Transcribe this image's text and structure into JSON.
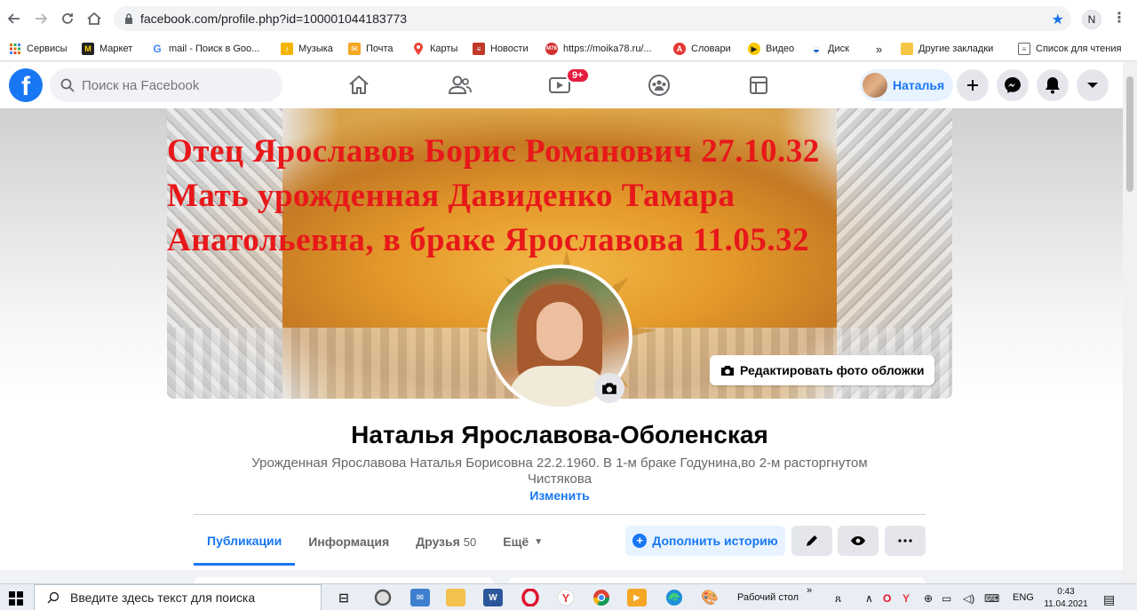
{
  "browser": {
    "url": "facebook.com/profile.php?id=100001044183773",
    "profile_initial": "N",
    "kebab": "⋮"
  },
  "bookmarks": [
    {
      "label": "Сервисы",
      "icon": "apps-icon",
      "color": "#e37400"
    },
    {
      "label": "Маркет",
      "icon": "yandex-market-icon",
      "color": "#222222"
    },
    {
      "label": "mail - Поиск в Goo...",
      "icon": "google-icon",
      "color": "#4285f4"
    },
    {
      "label": "Музыка",
      "icon": "music-icon",
      "color": "#f4b400"
    },
    {
      "label": "Почта",
      "icon": "mail-icon",
      "color": "#f5a623"
    },
    {
      "label": "Карты",
      "icon": "maps-pin-icon",
      "color": "#ea4335"
    },
    {
      "label": "Новости",
      "icon": "news-icon",
      "color": "#c0392b"
    },
    {
      "label": "https://moika78.ru/...",
      "icon": "moika-icon",
      "color": "#d32f2f"
    },
    {
      "label": "Словари",
      "icon": "dictionary-icon",
      "color": "#e53935"
    },
    {
      "label": "Видео",
      "icon": "video-icon",
      "color": "#f9c900"
    },
    {
      "label": "Диск",
      "icon": "disk-icon",
      "color": "#1e63c6"
    },
    {
      "label": "»",
      "icon": "more-icon",
      "color": "#5f6368"
    },
    {
      "label": "Другие закладки",
      "icon": "folder-icon",
      "color": "#f6c744"
    },
    {
      "label": "Список для чтения",
      "icon": "reading-list-icon",
      "color": "#5f6368"
    }
  ],
  "header": {
    "search_placeholder": "Поиск на Facebook",
    "watch_badge": "9+",
    "user_name": "Наталья"
  },
  "cover": {
    "lines": [
      "Отец   Ярославов Борис Романович 27.10.32",
      "Мать урожденная Давиденко Тамара",
      "Анатольевна, в браке Ярославова    11.05.32"
    ],
    "edit_label": "Редактировать фото обложки"
  },
  "profile": {
    "name": "Наталья Ярославова-Оболенская",
    "bio": "Урожденная Ярославова Наталья Борисовна 22.2.1960. В 1-м браке Годунина,во 2-м расторгнутом Чистякова",
    "edit_bio": "Изменить"
  },
  "tabs": [
    {
      "label": "Публикации",
      "active": true
    },
    {
      "label": "Информация",
      "active": false
    },
    {
      "label": "Друзья",
      "count": "50",
      "active": false
    },
    {
      "label": "Ещё",
      "active": false
    }
  ],
  "actions": {
    "add_story": "Дополнить историю"
  },
  "taskbar": {
    "search_placeholder": "Введите здесь текст для поиска",
    "desktop_label": "Рабочий стол",
    "chevron": "»",
    "lang": "ENG",
    "time": "0:43",
    "date": "11.04.2021"
  },
  "colors": {
    "fb_blue": "#1877f2",
    "cover_text": "#e8181a",
    "badge_red": "#e41e3f"
  }
}
